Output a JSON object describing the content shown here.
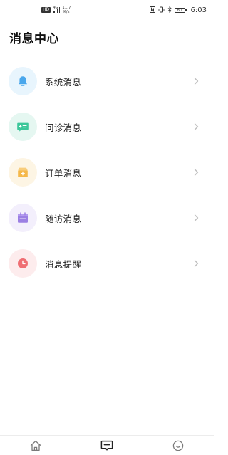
{
  "status_bar": {
    "hd_badge": "HD",
    "network": "4G",
    "speed_value": "11.7",
    "speed_unit": "K/s",
    "battery": "80",
    "time": "6:03"
  },
  "header": {
    "title": "消息中心"
  },
  "messages": {
    "items": [
      {
        "label": "系统消息",
        "icon": "bell-icon",
        "bg": "#e8f5fd",
        "color": "#4aa7ec"
      },
      {
        "label": "问诊消息",
        "icon": "chat-card-icon",
        "bg": "#e5f7f1",
        "color": "#3cc79a"
      },
      {
        "label": "订单消息",
        "icon": "package-icon",
        "bg": "#fdf5e4",
        "color": "#f5b84a"
      },
      {
        "label": "随访消息",
        "icon": "calendar-icon",
        "bg": "#f3effc",
        "color": "#9b7fe3"
      },
      {
        "label": "消息提醒",
        "icon": "clock-icon",
        "bg": "#fdeced",
        "color": "#ef6e73"
      }
    ]
  },
  "bottom_nav": {
    "items": [
      {
        "icon": "home-icon",
        "active": false
      },
      {
        "icon": "message-icon",
        "active": true
      },
      {
        "icon": "smile-icon",
        "active": false
      }
    ]
  },
  "colors": {
    "chevron": "#bdbdbd",
    "nav_inactive": "#7a7a7a",
    "nav_active": "#222222"
  }
}
